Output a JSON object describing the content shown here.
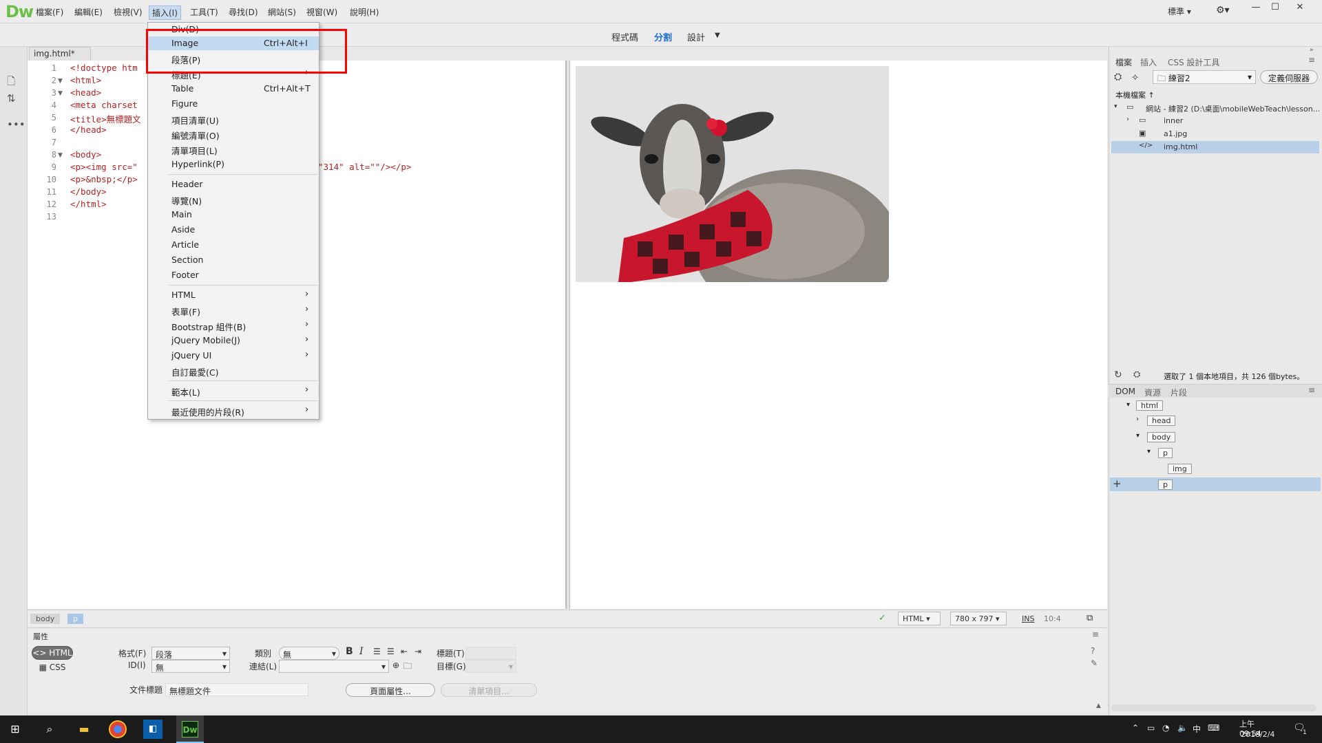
{
  "app": {
    "logo": "Dw",
    "menu": [
      "檔案(F)",
      "編輯(E)",
      "檢視(V)",
      "插入(I)",
      "工具(T)",
      "尋找(D)",
      "網站(S)",
      "視窗(W)",
      "說明(H)"
    ],
    "workspace": "標準",
    "win_min": "—",
    "win_max": "☐",
    "win_close": "✕"
  },
  "views": {
    "code": "程式碼",
    "split": "分割",
    "design": "設計"
  },
  "doc_tab": {
    "name": "img.html*",
    "close": "×"
  },
  "code": {
    "line_numbers": [
      "1",
      "2",
      "3",
      "4",
      "5",
      "6",
      "7",
      "8",
      "9",
      "10",
      "11",
      "12",
      "13"
    ],
    "lines": [
      "<!doctype htm",
      "<html>",
      "<head>",
      "<meta charset",
      "<title>無標題文",
      "</head>",
      "",
      "<body>",
      "<p><img src=\"",
      "<p>&nbsp;</p>",
      "</body>",
      "</html>",
      ""
    ],
    "line9_tail": "\"314\" alt=\"\"/></p>"
  },
  "insert_menu": {
    "items": [
      {
        "label": "Div(D)",
        "shortcut": "",
        "arrow": ""
      },
      {
        "label": "Image",
        "shortcut": "Ctrl+Alt+I",
        "arrow": ""
      },
      {
        "label": "段落(P)",
        "shortcut": "",
        "arrow": ""
      },
      {
        "label": "標題(E)",
        "shortcut": "",
        "arrow": "›"
      },
      {
        "label": "Table",
        "shortcut": "Ctrl+Alt+T",
        "arrow": ""
      },
      {
        "label": "Figure",
        "shortcut": "",
        "arrow": ""
      },
      {
        "label": "項目清單(U)",
        "shortcut": "",
        "arrow": ""
      },
      {
        "label": "編號清單(O)",
        "shortcut": "",
        "arrow": ""
      },
      {
        "label": "清單項目(L)",
        "shortcut": "",
        "arrow": ""
      },
      {
        "label": "Hyperlink(P)",
        "shortcut": "",
        "arrow": ""
      },
      {
        "label": "Header",
        "shortcut": "",
        "arrow": ""
      },
      {
        "label": "導覽(N)",
        "shortcut": "",
        "arrow": ""
      },
      {
        "label": "Main",
        "shortcut": "",
        "arrow": ""
      },
      {
        "label": "Aside",
        "shortcut": "",
        "arrow": ""
      },
      {
        "label": "Article",
        "shortcut": "",
        "arrow": ""
      },
      {
        "label": "Section",
        "shortcut": "",
        "arrow": ""
      },
      {
        "label": "Footer",
        "shortcut": "",
        "arrow": ""
      },
      {
        "label": "HTML",
        "shortcut": "",
        "arrow": "›"
      },
      {
        "label": "表單(F)",
        "shortcut": "",
        "arrow": "›"
      },
      {
        "label": "Bootstrap 組件(B)",
        "shortcut": "",
        "arrow": "›"
      },
      {
        "label": "jQuery Mobile(J)",
        "shortcut": "",
        "arrow": "›"
      },
      {
        "label": "jQuery UI",
        "shortcut": "",
        "arrow": "›"
      },
      {
        "label": "自訂最愛(C)",
        "shortcut": "",
        "arrow": ""
      },
      {
        "label": "範本(L)",
        "shortcut": "",
        "arrow": "›"
      },
      {
        "label": "最近使用的片段(R)",
        "shortcut": "",
        "arrow": "›"
      }
    ]
  },
  "status": {
    "tags": [
      "body",
      "p"
    ],
    "language": "HTML",
    "window_size": "780 x 797",
    "mode": "INS",
    "cursor": "10:4"
  },
  "properties": {
    "title": "屬性",
    "html_btn": "HTML",
    "css_btn": "CSS",
    "format_label": "格式(F)",
    "format_value": "段落",
    "id_label": "ID(I)",
    "id_value": "無",
    "class_label": "類別",
    "class_value": "無",
    "link_label": "連結(L)",
    "target_label": "目標(G)",
    "title_label": "標題(T)",
    "doc_title_label": "文件標題",
    "doc_title_value": "無標題文件",
    "page_props_btn": "頁面屬性...",
    "list_item_btn": "清單項目..."
  },
  "files_panel": {
    "tabs": [
      "檔案",
      "插入",
      "CSS 設計工具"
    ],
    "site_select": "練習2",
    "manage_btn": "定義伺服器",
    "local_label": "本機檔案 ↑",
    "tree": [
      {
        "label": "網站 - 練習2 (D:\\桌面\\mobileWebTeach\\lesson...",
        "icon": "▭"
      },
      {
        "label": "inner",
        "icon": "▭"
      },
      {
        "label": "a1.jpg",
        "icon": "▣"
      },
      {
        "label": "img.html",
        "icon": "</>"
      }
    ],
    "status_text": "選取了 1 個本地項目，共 126 個bytes。"
  },
  "dom_panel": {
    "tabs": [
      "DOM",
      "資源",
      "片段"
    ],
    "nodes": [
      "html",
      "head",
      "body",
      "p",
      "img",
      "p"
    ]
  },
  "taskbar": {
    "time": "上午 09:54",
    "date": "2018/2/4",
    "ime": "中",
    "notif_count": "1"
  }
}
